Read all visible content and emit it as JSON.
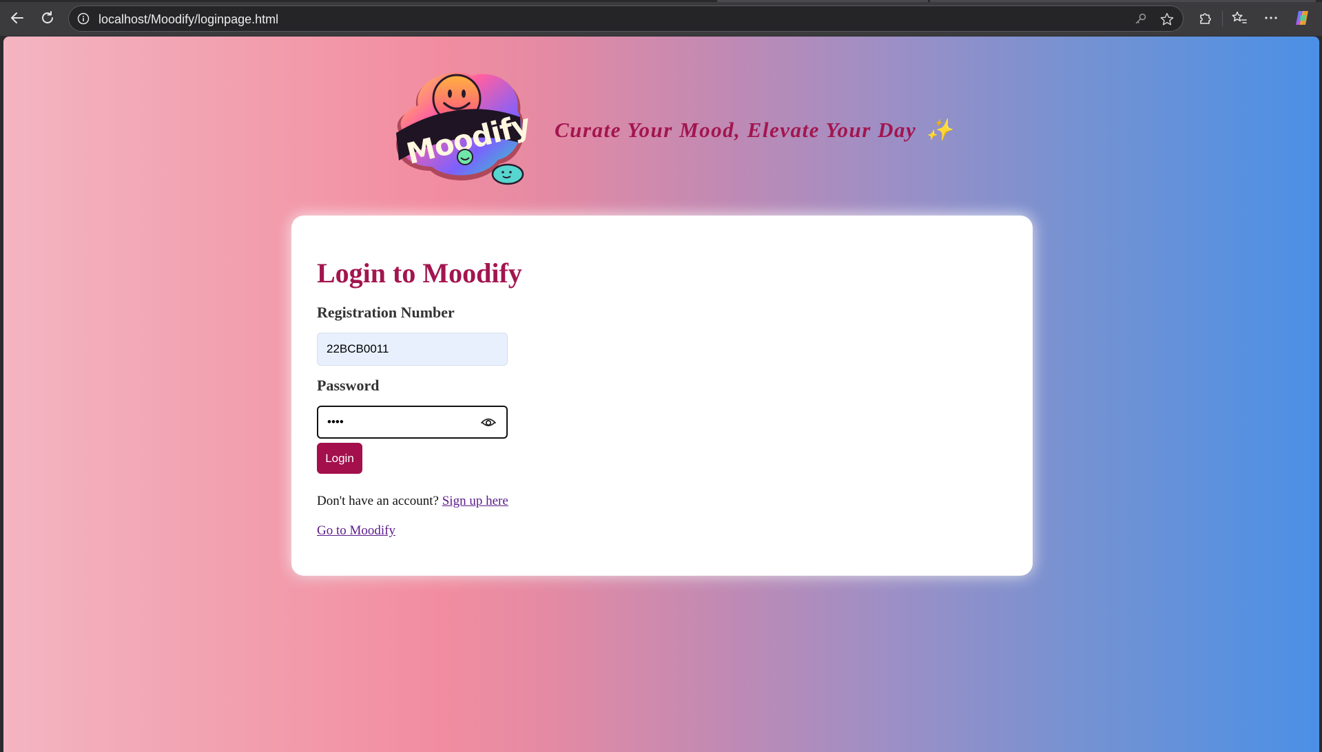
{
  "browser": {
    "url": "localhost/Moodify/loginpage.html"
  },
  "header": {
    "logo_text": "Moodify",
    "tagline": "Curate Your Mood, Elevate Your Day",
    "tagline_emoji": "✨"
  },
  "login": {
    "title": "Login to Moodify",
    "registration_label": "Registration Number",
    "registration_value": "22BCB0011",
    "password_label": "Password",
    "password_value": "••••",
    "login_button": "Login",
    "signup_prompt": "Don't have an account?",
    "signup_link": "Sign up here",
    "go_link": "Go to Moodify"
  },
  "colors": {
    "brand": "#a3154f",
    "link": "#5b1a8a"
  },
  "icons": {
    "back": "back-arrow-icon",
    "reload": "reload-icon",
    "info": "info-icon",
    "key": "key-icon",
    "star": "star-icon",
    "extensions": "puzzle-icon",
    "favorites": "favorites-icon",
    "menu": "more-icon",
    "copilot": "copilot-icon",
    "eye": "eye-icon"
  }
}
